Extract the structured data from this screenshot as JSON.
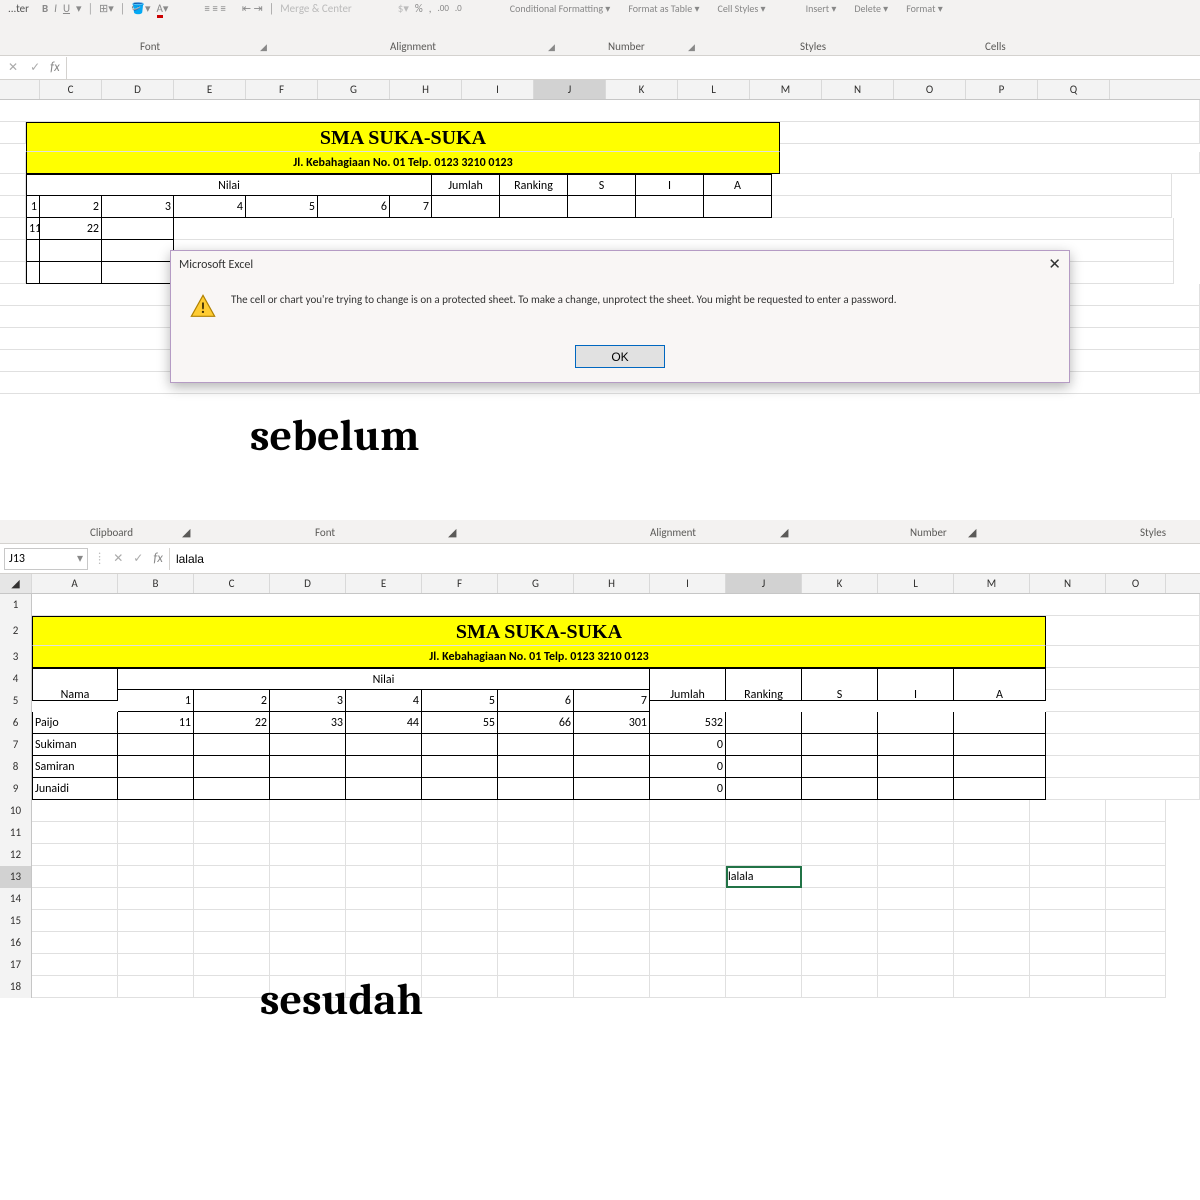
{
  "top": {
    "ribbon": {
      "groups": {
        "font": "Font",
        "alignment": "Alignment",
        "number": "Number",
        "styles": "Styles",
        "cells": "Cells"
      },
      "merge_center": "Merge & Center",
      "styles_btns": {
        "conditional": "Conditional Formatting ▾",
        "format_as": "Format as Table ▾",
        "cell_styles": "Cell Styles ▾"
      },
      "cells_btns": {
        "insert": "Insert ▾",
        "delete": "Delete ▾",
        "format": "Format ▾"
      },
      "painter_label": "...ter"
    },
    "fx_symbol": "fx",
    "col_letters": [
      "C",
      "D",
      "E",
      "F",
      "G",
      "H",
      "I",
      "J",
      "K",
      "L",
      "M",
      "N",
      "O",
      "P",
      "Q"
    ],
    "school_name": "SMA SUKA-SUKA",
    "school_addr": "Jl. Kebahagiaan No. 01 Telp. 0123 3210 0123",
    "nilai": "Nilai",
    "headers": {
      "jumlah": "Jumlah",
      "ranking": "Ranking",
      "s": "S",
      "i": "I",
      "a": "A"
    },
    "col_nums": [
      "1",
      "2",
      "3",
      "4",
      "5",
      "6",
      "7"
    ],
    "data_row": [
      "11",
      "22"
    ],
    "dialog": {
      "title": "Microsoft Excel",
      "message": "The cell or chart you're trying to change is on a protected sheet. To make a change, unprotect the sheet. You might be requested to enter a password.",
      "ok": "OK"
    },
    "big_label": "sebelum"
  },
  "bottom": {
    "ribbon_groups": {
      "clipboard": "Clipboard",
      "font": "Font",
      "alignment": "Alignment",
      "number": "Number",
      "styles": "Styles"
    },
    "name_box": "J13",
    "fx_symbol": "fx",
    "fx_value": "lalala",
    "col_letters": [
      "A",
      "B",
      "C",
      "D",
      "E",
      "F",
      "G",
      "H",
      "I",
      "J",
      "K",
      "L",
      "M",
      "N",
      "O"
    ],
    "row_nums": [
      "1",
      "2",
      "3",
      "4",
      "5",
      "6",
      "7",
      "8",
      "9",
      "10",
      "11",
      "12",
      "13",
      "14",
      "15",
      "16",
      "17",
      "18"
    ],
    "school_name": "SMA SUKA-SUKA",
    "school_addr": "Jl. Kebahagiaan No. 01 Telp. 0123 3210 0123",
    "nama": "Nama",
    "nilai": "Nilai",
    "headers": {
      "jumlah": "Jumlah",
      "ranking": "Ranking",
      "s": "S",
      "i": "I",
      "a": "A"
    },
    "col_nums": [
      "1",
      "2",
      "3",
      "4",
      "5",
      "6",
      "7"
    ],
    "students": [
      {
        "name": "Paijo",
        "n": [
          "11",
          "22",
          "33",
          "44",
          "55",
          "66",
          "301"
        ],
        "jumlah": "532"
      },
      {
        "name": "Sukiman",
        "n": [
          "",
          "",
          "",
          "",
          "",
          "",
          ""
        ],
        "jumlah": "0"
      },
      {
        "name": "Samiran",
        "n": [
          "",
          "",
          "",
          "",
          "",
          "",
          ""
        ],
        "jumlah": "0"
      },
      {
        "name": "Junaidi",
        "n": [
          "",
          "",
          "",
          "",
          "",
          "",
          ""
        ],
        "jumlah": "0"
      }
    ],
    "j13_value": "lalala",
    "big_label": "sesudah"
  }
}
